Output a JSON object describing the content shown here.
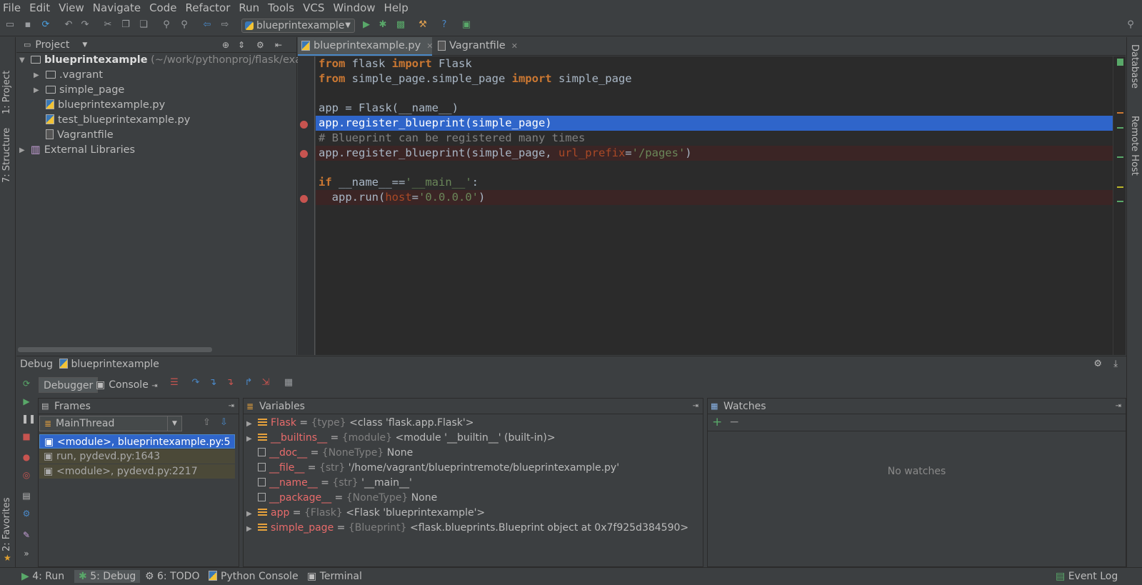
{
  "menu": [
    "File",
    "Edit",
    "View",
    "Navigate",
    "Code",
    "Refactor",
    "Run",
    "Tools",
    "VCS",
    "Window",
    "Help"
  ],
  "toolbar": {
    "run_config": "blueprintexample",
    "icons": [
      "open-icon",
      "save-icon",
      "sync-icon",
      "undo-icon",
      "redo-icon",
      "cut-icon",
      "copy-icon",
      "paste-icon",
      "find-icon",
      "replace-icon",
      "back-icon",
      "forward-icon",
      "run-icon",
      "debug-icon",
      "coverage-icon",
      "settings-icon",
      "help-icon",
      "sdk-icon",
      "search-icon"
    ]
  },
  "left_stripe": {
    "project": "1: Project",
    "structure": "7: Structure",
    "favorites": "2: Favorites"
  },
  "right_stripe": {
    "database": "Database",
    "remote_host": "Remote Host"
  },
  "project": {
    "header": "Project",
    "root_name": "blueprintexample",
    "root_path": "(~/work/pythonproj/flask/exam",
    "items": [
      {
        "label": ".vagrant",
        "kind": "folder"
      },
      {
        "label": "simple_page",
        "kind": "folder"
      },
      {
        "label": "blueprintexample.py",
        "kind": "py"
      },
      {
        "label": "test_blueprintexample.py",
        "kind": "py"
      },
      {
        "label": "Vagrantfile",
        "kind": "file"
      }
    ],
    "external": "External Libraries"
  },
  "editor": {
    "tabs": [
      {
        "label": "blueprintexample.py",
        "active": true
      },
      {
        "label": "Vagrantfile",
        "active": false
      }
    ]
  },
  "code": {
    "l1": {
      "kw1": "from",
      "mid": " flask ",
      "kw2": "import",
      "end": " Flask"
    },
    "l2": {
      "kw1": "from",
      "mid": " simple_page.simple_page ",
      "kw2": "import",
      "end": " simple_page"
    },
    "l4": "app = Flask(__name__)",
    "l5": "app.register_blueprint(simple_page)",
    "l6": "# Blueprint can be registered many times",
    "l7": {
      "a": "app.register_blueprint(simple_page, ",
      "param": "url_prefix",
      "eq": "=",
      "str": "'/pages'",
      "end": ")"
    },
    "l9": {
      "kw": "if",
      "a": " __name__==",
      "str": "'__main__'",
      "end": ":"
    },
    "l10": {
      "a": "  app.run(",
      "param": "host",
      "eq": "=",
      "str": "'0.0.0.0'",
      "end": ")"
    }
  },
  "debug": {
    "title": "Debug",
    "config": "blueprintexample",
    "tabs": [
      "Debugger",
      "Console"
    ],
    "frames": {
      "header": "Frames",
      "thread": "MainThread",
      "rows": [
        "<module>, blueprintexample.py:5",
        "run, pydevd.py:1643",
        "<module>, pydevd.py:2217"
      ]
    },
    "variables": {
      "header": "Variables",
      "rows": [
        {
          "name": "Flask",
          "type": "{type}",
          "value": "<class 'flask.app.Flask'>",
          "expandable": true
        },
        {
          "name": "__builtins__",
          "type": "{module}",
          "value": "<module '__builtin__' (built-in)>",
          "expandable": true
        },
        {
          "name": "__doc__",
          "type": "{NoneType}",
          "value": "None",
          "expandable": false
        },
        {
          "name": "__file__",
          "type": "{str}",
          "value": "'/home/vagrant/blueprintremote/blueprintexample.py'",
          "expandable": false
        },
        {
          "name": "__name__",
          "type": "{str}",
          "value": "'__main__'",
          "expandable": false
        },
        {
          "name": "__package__",
          "type": "{NoneType}",
          "value": "None",
          "expandable": false
        },
        {
          "name": "app",
          "type": "{Flask}",
          "value": "<Flask 'blueprintexample'>",
          "expandable": true
        },
        {
          "name": "simple_page",
          "type": "{Blueprint}",
          "value": "<flask.blueprints.Blueprint object at 0x7f925d384590>",
          "expandable": true
        }
      ]
    },
    "watches": {
      "header": "Watches",
      "empty": "No watches"
    }
  },
  "statusbar": {
    "run": "4: Run",
    "debug": "5: Debug",
    "todo": "6: TODO",
    "python_console": "Python Console",
    "terminal": "Terminal",
    "event_log": "Event Log"
  },
  "colors": {
    "selection": "#2f65ca",
    "breakpoint_line": "#3b2525",
    "breakpoint": "#c75450",
    "keyword": "#cc7832",
    "string": "#6a8759"
  }
}
